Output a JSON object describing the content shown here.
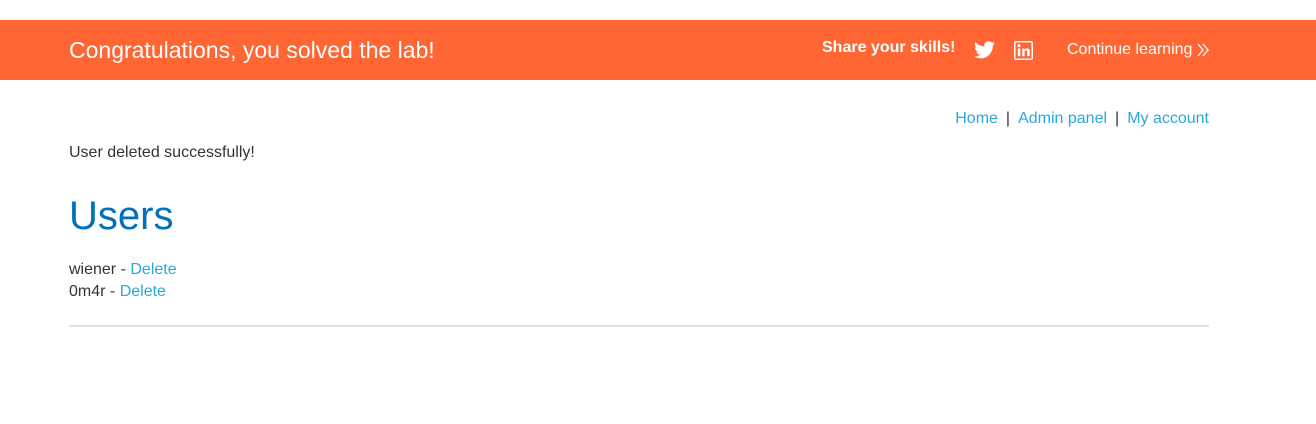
{
  "banner": {
    "title": "Congratulations, you solved the lab!",
    "share_label": "Share your skills!",
    "twitter_icon": "twitter-icon",
    "linkedin_icon": "linkedin-icon",
    "continue_label": "Continue learning",
    "background_color": "#ff6633"
  },
  "nav": {
    "items": [
      {
        "label": "Home"
      },
      {
        "label": "Admin panel"
      },
      {
        "label": "My account"
      }
    ],
    "separator": "|"
  },
  "message": "User deleted successfully!",
  "heading": "Users",
  "users": [
    {
      "name": "wiener",
      "separator": "-",
      "action": "Delete"
    },
    {
      "name": "0m4r",
      "separator": "-",
      "action": "Delete"
    }
  ],
  "colors": {
    "link": "#29a9d9",
    "heading": "#0071bc",
    "text": "#333333"
  }
}
